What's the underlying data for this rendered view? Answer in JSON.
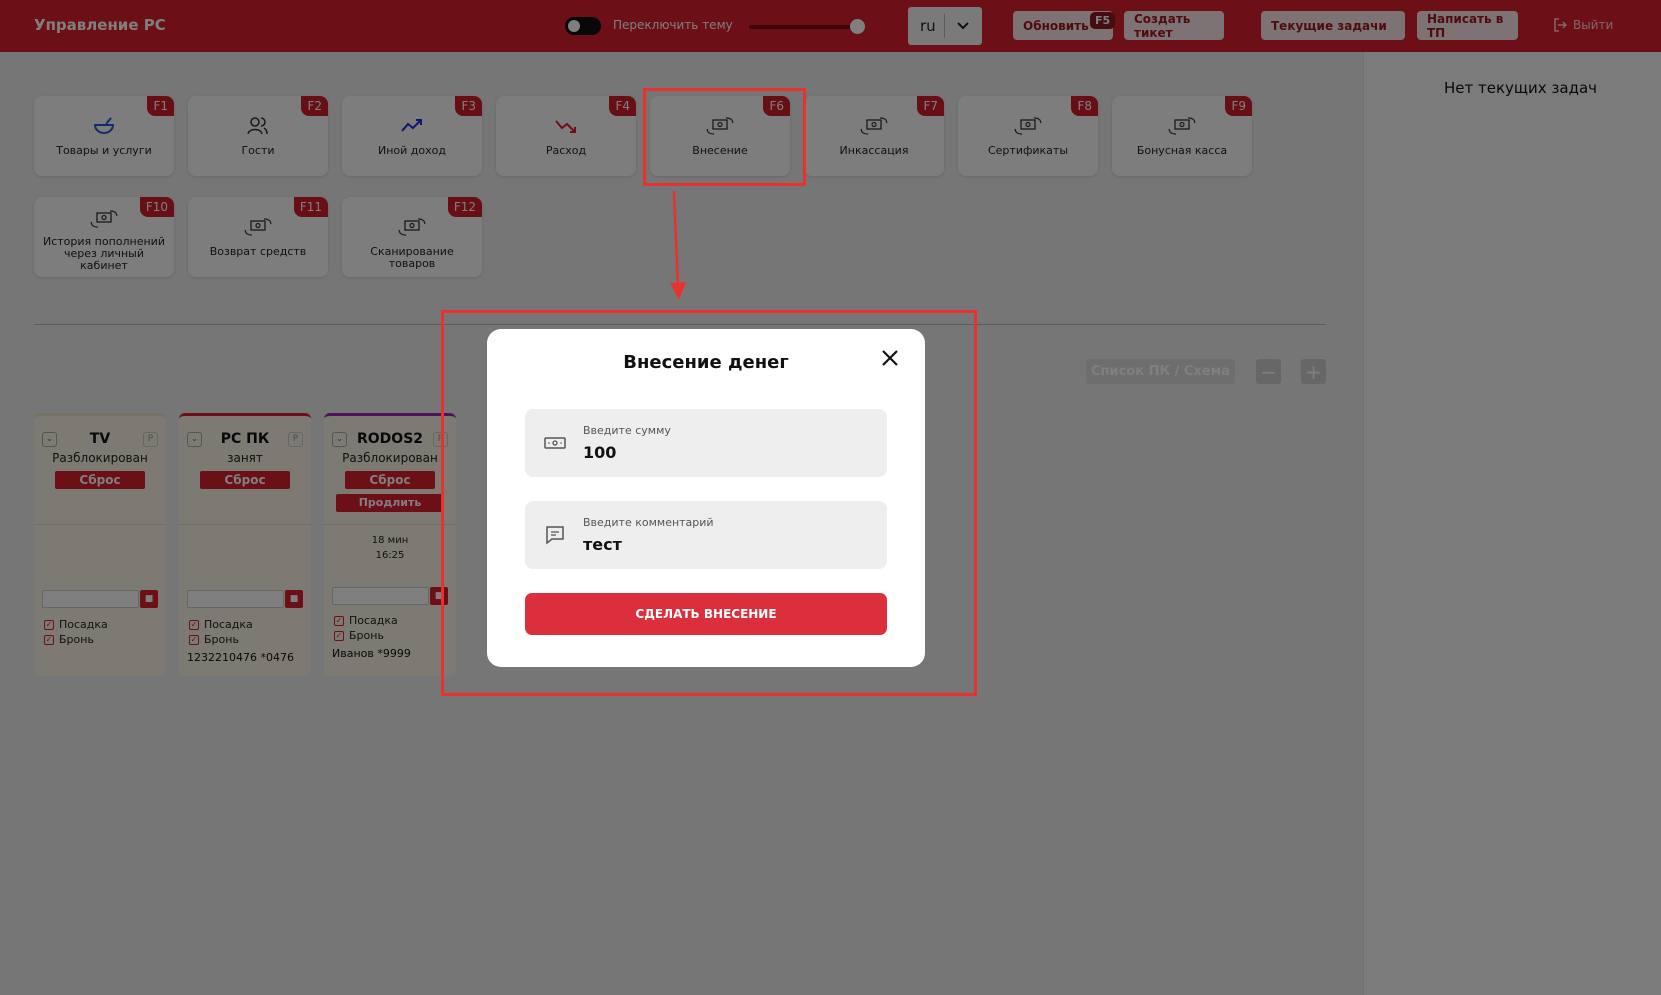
{
  "header": {
    "title": "Управление РС",
    "theme_label": "Переключить тему",
    "language": "ru",
    "refresh_label": "Обновить",
    "refresh_key": "F5",
    "create_ticket_label": "Создать тикет",
    "current_tasks_label": "Текущие задачи",
    "write_support_label": "Написать в ТП",
    "logout_label": "Выйти",
    "accent_color": "#d81e2c"
  },
  "tiles": [
    {
      "label": "Товары и услуги",
      "key": "F1",
      "icon": "bowl-icon"
    },
    {
      "label": "Гости",
      "key": "F2",
      "icon": "users-icon"
    },
    {
      "label": "Иной доход",
      "key": "F3",
      "icon": "trend-up-icon"
    },
    {
      "label": "Расход",
      "key": "F4",
      "icon": "trend-down-icon"
    },
    {
      "label": "Внесение",
      "key": "F6",
      "icon": "money-exchange-icon"
    },
    {
      "label": "Инкассация",
      "key": "F7",
      "icon": "money-exchange-icon"
    },
    {
      "label": "Сертификаты",
      "key": "F8",
      "icon": "money-exchange-icon"
    },
    {
      "label": "Бонусная касса",
      "key": "F9",
      "icon": "money-exchange-icon"
    },
    {
      "label": "История пополнений через личный кабинет",
      "key": "F10",
      "icon": "money-exchange-icon"
    },
    {
      "label": "Возврат средств",
      "key": "F11",
      "icon": "money-exchange-icon"
    },
    {
      "label": "Сканирование товаров",
      "key": "F12",
      "icon": "money-exchange-icon"
    }
  ],
  "view": {
    "toggle_label": "Список ПК / Схема",
    "zoom_out": "−",
    "zoom_in": "+"
  },
  "pcs": [
    {
      "name": "TV",
      "p": "P",
      "status": "Разблокирован",
      "reset": "Сброс",
      "seat": "Посадка",
      "booking": "Бронь",
      "owner": ""
    },
    {
      "name": "PC ПК",
      "p": "P",
      "status": "занят",
      "reset": "Сброс",
      "seat": "Посадка",
      "booking": "Бронь",
      "owner": "1232210476 *0476"
    },
    {
      "name": "RODOS2",
      "p": "P",
      "status": "Разблокирован",
      "reset": "Сброс",
      "extend": "Продлить",
      "time_left": "18 мин",
      "time_end": "16:25",
      "seat": "Посадка",
      "booking": "Бронь",
      "owner": "Иванов *9999"
    }
  ],
  "right_panel": {
    "empty_text": "Нет текущих задач"
  },
  "modal": {
    "title": "Внесение денег",
    "amount_label": "Введите сумму",
    "amount_value": "100",
    "comment_label": "Введите комментарий",
    "comment_value": "тест",
    "submit_label": "СДЕЛАТЬ ВНЕСЕНИЕ"
  }
}
